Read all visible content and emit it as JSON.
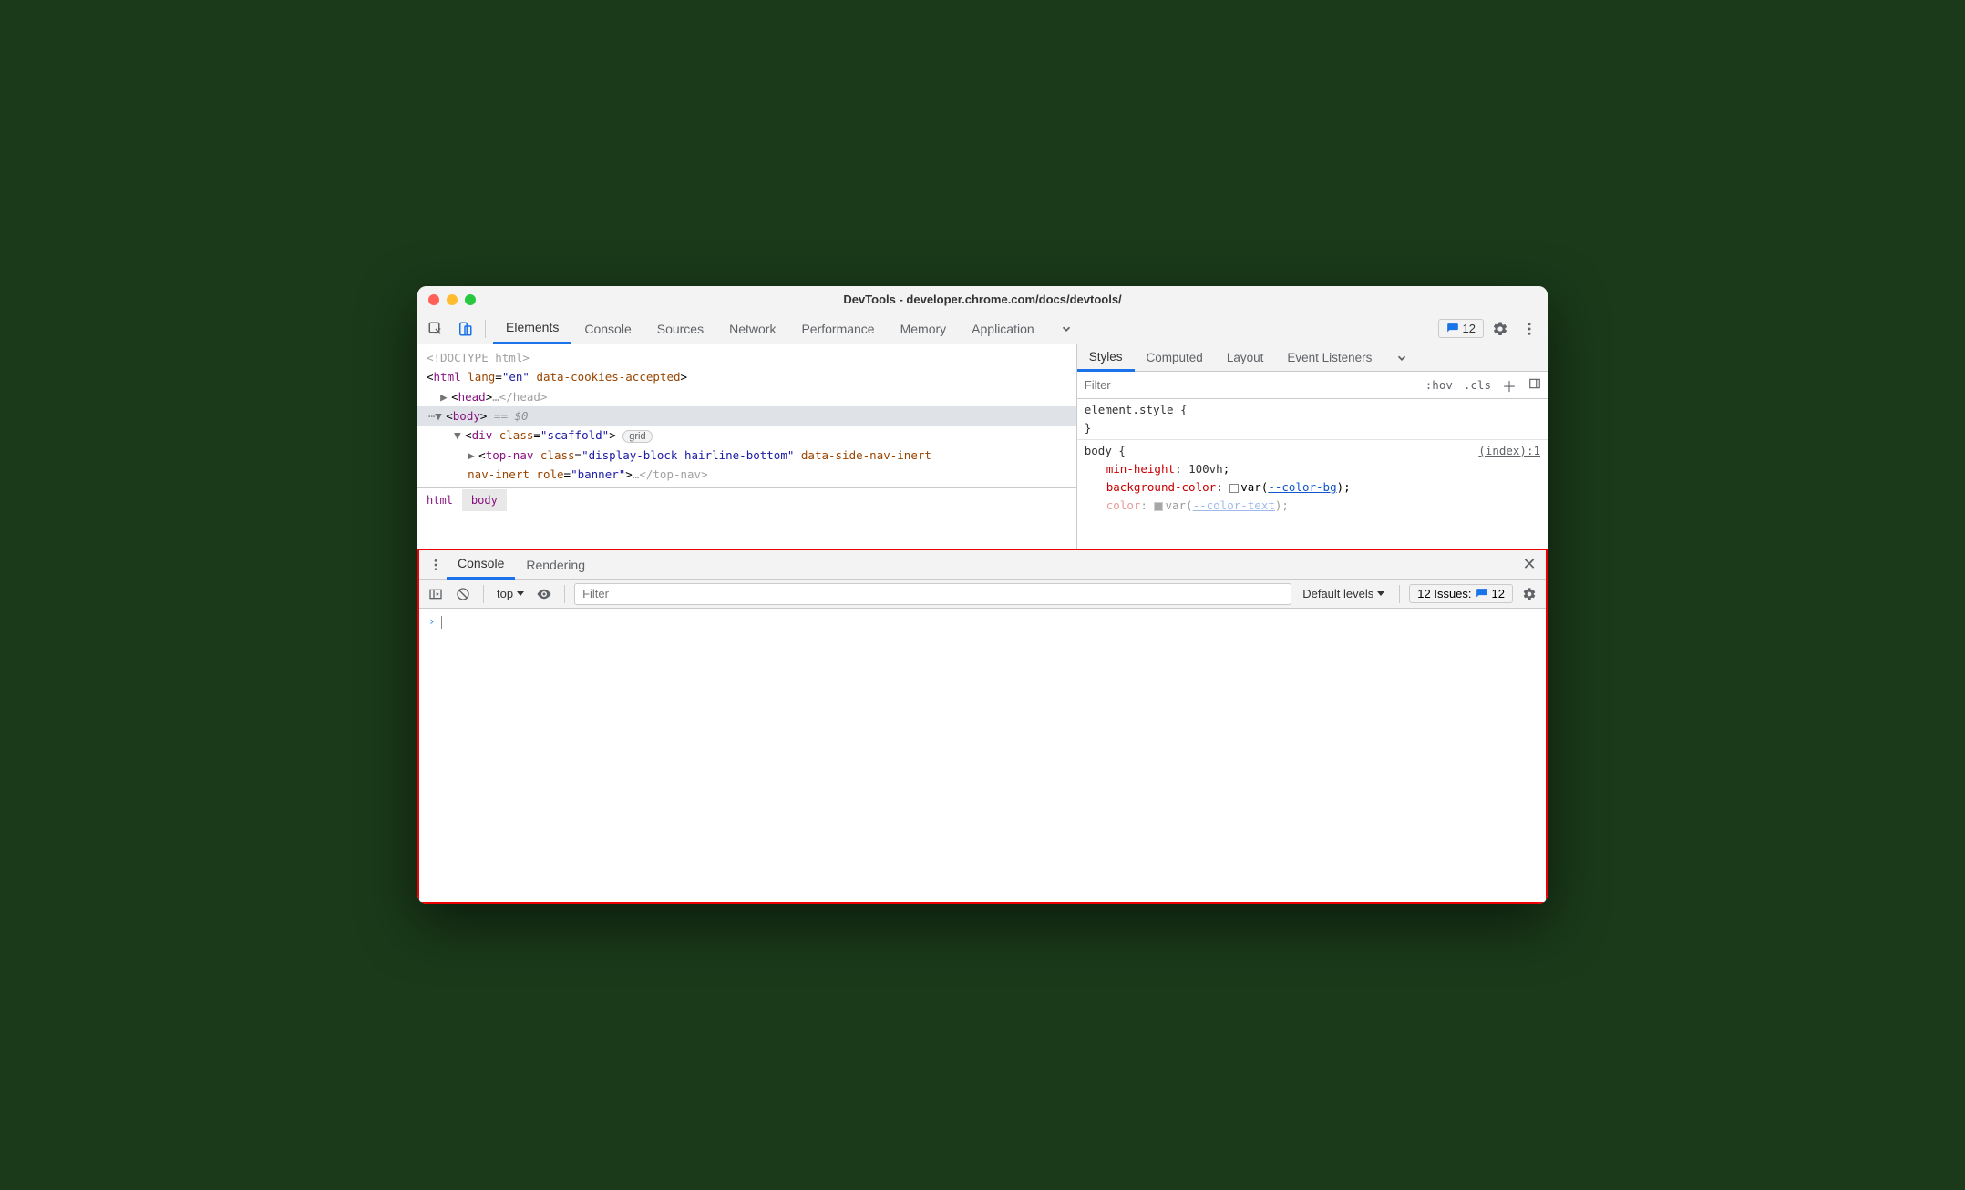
{
  "window_title": "DevTools - developer.chrome.com/docs/devtools/",
  "toolbar": {
    "tabs": [
      "Elements",
      "Console",
      "Sources",
      "Network",
      "Performance",
      "Memory",
      "Application"
    ],
    "active_tab": "Elements",
    "issues_count": "12"
  },
  "dom_tree": {
    "line0": "<!DOCTYPE html>",
    "html_tag": "html",
    "html_attr_lang": "lang",
    "html_lang_val": "\"en\"",
    "html_attr2": "data-cookies-accepted",
    "head_tag": "head",
    "head_close": "…</head>",
    "body_tag": "body",
    "body_equals": " == ",
    "body_dollar": "$0",
    "div_tag": "div",
    "div_class_attr": "class",
    "div_class_val": "\"scaffold\"",
    "div_pill": "grid",
    "topnav_tag": "top-nav",
    "topnav_class_attr": "class",
    "topnav_class_val": "\"display-block hairline-bottom\"",
    "topnav_attr2": "data-side-nav-inert",
    "topnav_role_attr": "role",
    "topnav_role_val": "\"banner\"",
    "topnav_close": "…</top-nav>",
    "dots": "⋯"
  },
  "breadcrumb": {
    "root": "html",
    "current": "body"
  },
  "styles": {
    "tabs": [
      "Styles",
      "Computed",
      "Layout",
      "Event Listeners"
    ],
    "active_tab": "Styles",
    "filter_placeholder": "Filter",
    "hov": ":hov",
    "cls": ".cls",
    "element_style_open": "element.style {",
    "element_style_close": "}",
    "body_sel": "body {",
    "body_link": "(index):1",
    "prop1_n": "min-height",
    "prop1_v": "100vh",
    "prop2_n": "background-color",
    "prop2_var": "--color-bg",
    "prop3_n": "color",
    "prop3_var": "--color-text"
  },
  "drawer": {
    "tabs": [
      "Console",
      "Rendering"
    ],
    "active_tab": "Console"
  },
  "console": {
    "context": "top",
    "filter_placeholder": "Filter",
    "levels": "Default levels",
    "issues_label": "12 Issues:",
    "issues_count": "12"
  }
}
